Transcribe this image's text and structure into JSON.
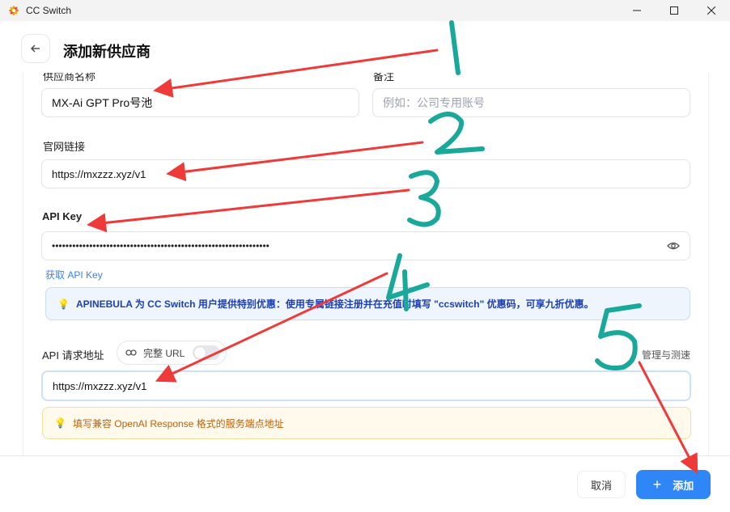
{
  "window": {
    "app_title": "CC Switch",
    "icon": "cc-switch-logo"
  },
  "header": {
    "back_icon": "arrow-left-icon",
    "title": "添加新供应商"
  },
  "form": {
    "provider_name": {
      "label": "供应商名称",
      "value": "MX-Ai GPT Pro号池"
    },
    "notes": {
      "label": "备注",
      "placeholder": "例如：公司专用账号"
    },
    "website": {
      "label": "官网链接",
      "value": "https://mxzzz.xyz/v1"
    },
    "api_key": {
      "label": "API Key",
      "masked_value": "••••••••••••••••••••••••••••••••••••••••••••••••••••••••••••••••",
      "get_key_link": "获取 API Key"
    },
    "promo": "APINEBULA 为 CC Switch 用户提供特别优惠：使用专属链接注册并在充值时填写 \"ccswitch\" 优惠码，可享九折优惠。",
    "endpoint": {
      "label": "API 请求地址",
      "full_url_toggle": "完整 URL",
      "manage_link": "管理与测速",
      "value": "https://mxzzz.xyz/v1",
      "hint": "填写兼容 OpenAI Response 格式的服务端点地址"
    }
  },
  "footer": {
    "cancel": "取消",
    "add": "添加",
    "add_symbol": "+"
  },
  "annotations": {
    "numbers": [
      "1",
      "2",
      "3",
      "4",
      "5"
    ],
    "arrow_color": "#ef3a3a",
    "number_color": "#1aa89a"
  },
  "colors": {
    "accent": "#2f86f6",
    "info_blue_bg": "#eef5fd",
    "info_yellow_bg": "#fffaeb"
  }
}
